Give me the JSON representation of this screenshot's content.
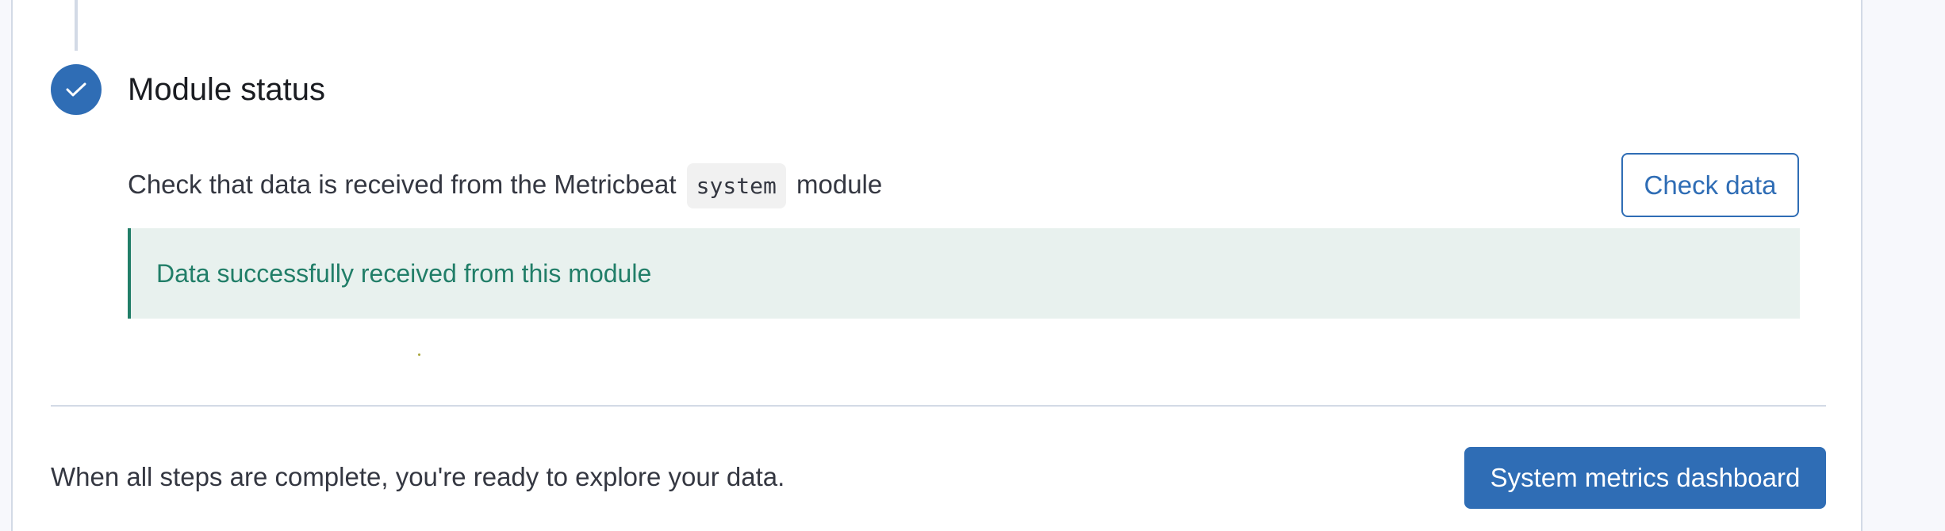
{
  "step": {
    "title": "Module status",
    "icon": "check-icon",
    "status_color": "#2f6db5"
  },
  "instruction": {
    "prefix": "Check that data is received from the Metricbeat",
    "module_code": "system",
    "suffix": "module"
  },
  "check_button": {
    "label": "Check data"
  },
  "callout": {
    "message": "Data successfully received from this module",
    "color": "#217e68"
  },
  "footer": {
    "text": "When all steps are complete, you're ready to explore your data.",
    "dashboard_button_label": "System metrics dashboard"
  }
}
